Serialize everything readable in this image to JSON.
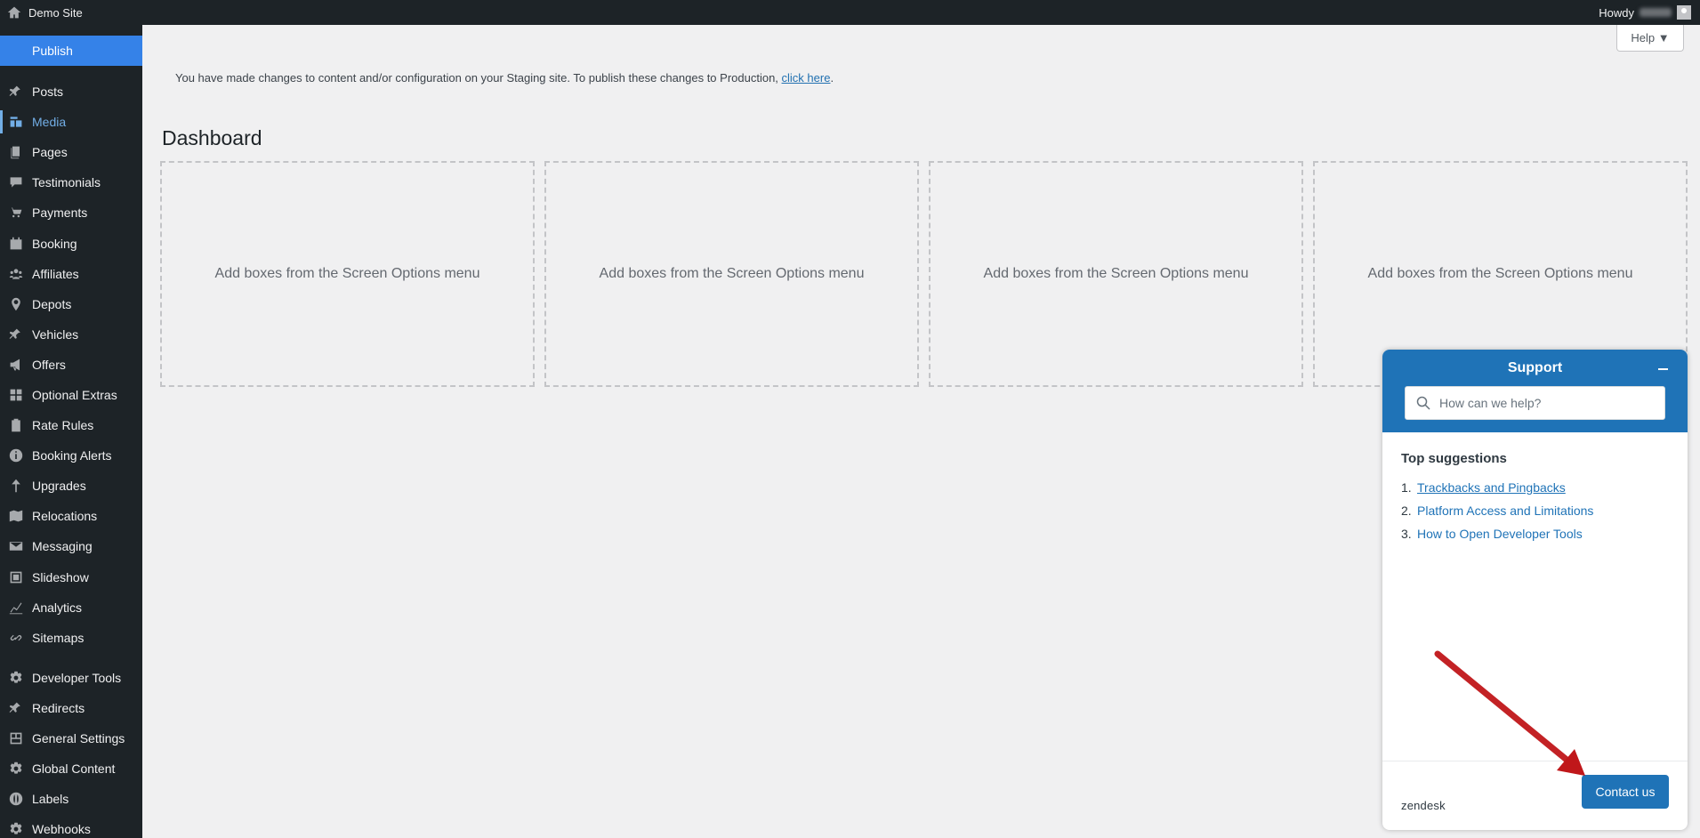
{
  "adminbar": {
    "site_name": "Demo Site",
    "howdy": "Howdy"
  },
  "sidebar": {
    "publish_label": "Publish",
    "items": [
      {
        "label": "Posts",
        "icon": "pin-icon"
      },
      {
        "label": "Media",
        "icon": "media-icon",
        "active": true
      },
      {
        "label": "Pages",
        "icon": "pages-icon"
      },
      {
        "label": "Testimonials",
        "icon": "comment-icon"
      },
      {
        "label": "Payments",
        "icon": "cart-icon"
      },
      {
        "label": "Booking",
        "icon": "calendar-icon"
      },
      {
        "label": "Affiliates",
        "icon": "groups-icon"
      },
      {
        "label": "Depots",
        "icon": "location-icon"
      },
      {
        "label": "Vehicles",
        "icon": "pin-icon"
      },
      {
        "label": "Offers",
        "icon": "megaphone-icon"
      },
      {
        "label": "Optional Extras",
        "icon": "grid-icon"
      },
      {
        "label": "Rate Rules",
        "icon": "clipboard-icon"
      },
      {
        "label": "Booking Alerts",
        "icon": "info-icon"
      },
      {
        "label": "Upgrades",
        "icon": "arrow-up-icon"
      },
      {
        "label": "Relocations",
        "icon": "map-icon"
      },
      {
        "label": "Messaging",
        "icon": "mail-icon"
      },
      {
        "label": "Slideshow",
        "icon": "slides-icon"
      },
      {
        "label": "Analytics",
        "icon": "chart-icon"
      },
      {
        "label": "Sitemaps",
        "icon": "link-icon"
      },
      {
        "label": "Developer Tools",
        "icon": "gear-icon"
      },
      {
        "label": "Redirects",
        "icon": "pin-icon"
      },
      {
        "label": "General Settings",
        "icon": "layout-icon"
      },
      {
        "label": "Global Content",
        "icon": "gear-icon"
      },
      {
        "label": "Labels",
        "icon": "globe-icon"
      },
      {
        "label": "Webhooks",
        "icon": "gear-icon"
      }
    ]
  },
  "help_label": "Help ▼",
  "notice": {
    "text": "You have made changes to content and/or configuration on your Staging site. To publish these changes to Production, ",
    "link": "click here",
    "after": "."
  },
  "page_title": "Dashboard",
  "boxes": [
    "Add boxes from the Screen Options menu",
    "Add boxes from the Screen Options menu",
    "Add boxes from the Screen Options menu",
    "Add boxes from the Screen Options menu"
  ],
  "support": {
    "title": "Support",
    "search_placeholder": "How can we help?",
    "suggestions_title": "Top suggestions",
    "suggestions": [
      {
        "num": "1.",
        "label": "Trackbacks and Pingbacks"
      },
      {
        "num": "2.",
        "label": "Platform Access and Limitations"
      },
      {
        "num": "3.",
        "label": "How to Open Developer Tools"
      }
    ],
    "brand": "zendesk",
    "contact_label": "Contact us"
  },
  "colors": {
    "admin_dark": "#1d2327",
    "publish_blue": "#3582e8",
    "active_blue": "#72aee6",
    "zendesk_blue": "#1f73b7",
    "arrow_red": "#c0171a"
  }
}
